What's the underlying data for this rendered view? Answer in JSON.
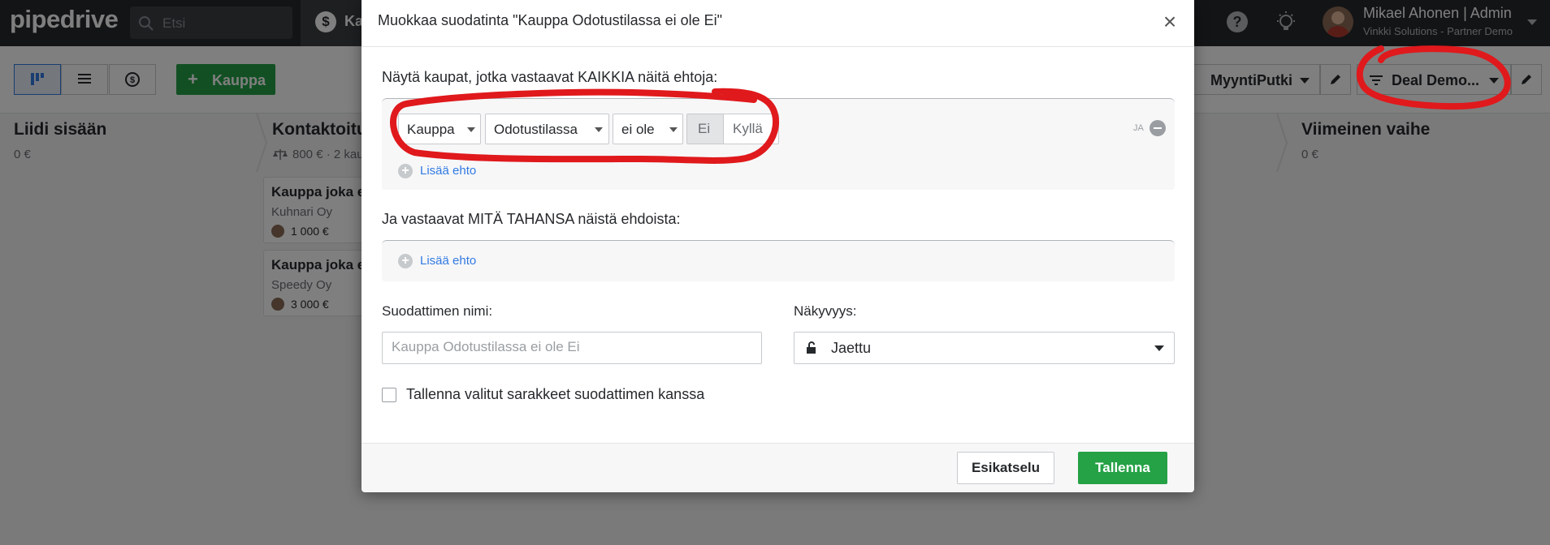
{
  "app": {
    "logo": "pipedrive"
  },
  "topbar": {
    "search_placeholder": "Etsi",
    "deals_label": "Ka",
    "user_name": "Mikael Ahonen | Admin",
    "user_company": "Vinkki Solutions - Partner Demo"
  },
  "toolbar": {
    "add_deal_label": "Kauppa",
    "pipeline_label": "MyyntiPutki",
    "filter_label": "Deal Demo..."
  },
  "stages": [
    {
      "name": "Liidi sisään",
      "sum": "0 €"
    },
    {
      "name": "Kontaktoitu",
      "sum": "800 € · 2 kaup"
    },
    {
      "name": "Viimeinen vaihe",
      "sum": "0 €"
    }
  ],
  "cards": [
    {
      "title": "Kauppa joka e",
      "company": "Kuhnari Oy",
      "value": "1 000 €"
    },
    {
      "title": "Kauppa joka e",
      "company": "Speedy Oy",
      "value": "3 000 €"
    }
  ],
  "modal": {
    "title": "Muokkaa suodatinta \"Kauppa Odotustilassa ei ole Ei\"",
    "all_conditions_label": "Näytä kaupat, jotka vastaavat KAIKKIA näitä ehtoja:",
    "condition": {
      "object": "Kauppa",
      "field": "Odotustilassa",
      "operator": "ei ole",
      "option_no": "Ei",
      "option_yes": "Kyllä",
      "and_label": "JA"
    },
    "add_condition_label": "Lisää ehto",
    "any_conditions_label": "Ja vastaavat MITÄ TAHANSA näistä ehdoista:",
    "filter_name_label": "Suodattimen nimi:",
    "filter_name_placeholder": "Kauppa Odotustilassa ei ole Ei",
    "visibility_label": "Näkyvyys:",
    "visibility_value": "Jaettu",
    "save_columns_label": "Tallenna valitut sarakkeet suodattimen kanssa",
    "preview_button": "Esikatselu",
    "save_button": "Tallenna"
  },
  "colors": {
    "accent_green": "#25a146",
    "link_blue": "#317ae2",
    "annotation_red": "#e0191c",
    "topbar": "#26292c"
  }
}
